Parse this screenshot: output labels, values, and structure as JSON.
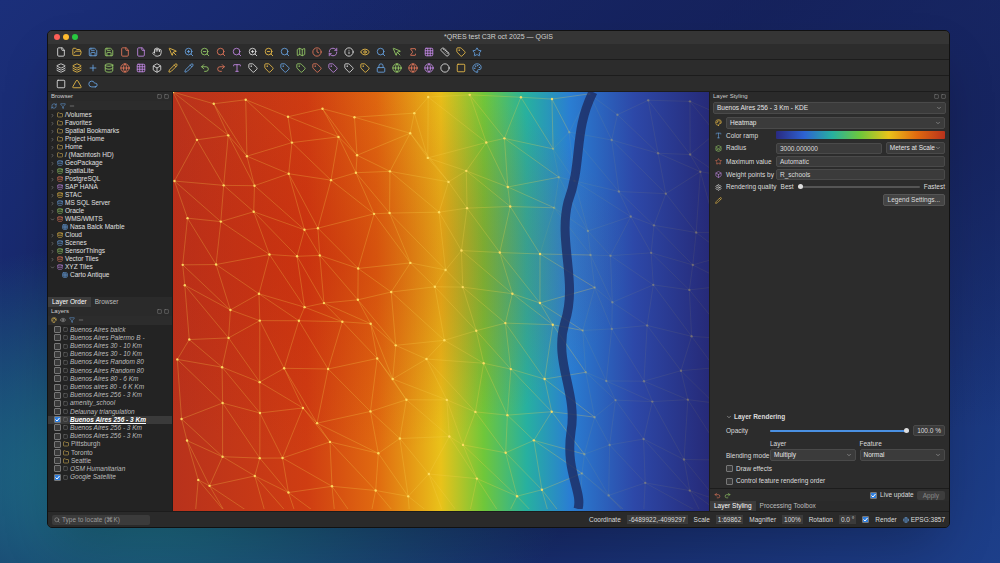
{
  "window": {
    "title": "*QRES test C3R oct 2025 — QGIS"
  },
  "browser": {
    "title": "Browser",
    "items": [
      {
        "label": "/Volumes",
        "kind": "group",
        "expanded": false
      },
      {
        "label": "Favorites",
        "kind": "group",
        "expanded": false
      },
      {
        "label": "Spatial Bookmarks",
        "kind": "group",
        "expanded": false
      },
      {
        "label": "Project Home",
        "kind": "group",
        "expanded": false
      },
      {
        "label": "Home",
        "kind": "group",
        "expanded": false
      },
      {
        "label": "/ (Macintosh HD)",
        "kind": "group",
        "expanded": false
      },
      {
        "label": "GeoPackage",
        "kind": "group",
        "expanded": false
      },
      {
        "label": "SpatiaLite",
        "kind": "group",
        "expanded": false
      },
      {
        "label": "PostgreSQL",
        "kind": "group",
        "expanded": false
      },
      {
        "label": "SAP HANA",
        "kind": "group",
        "expanded": false
      },
      {
        "label": "STAC",
        "kind": "group",
        "expanded": false
      },
      {
        "label": "MS SQL Server",
        "kind": "group",
        "expanded": false
      },
      {
        "label": "Oracle",
        "kind": "group",
        "expanded": false
      },
      {
        "label": "WMS/WMTS",
        "kind": "group",
        "expanded": true
      },
      {
        "label": "Nasa Balck Marble",
        "kind": "child",
        "expanded": false
      },
      {
        "label": "Cloud",
        "kind": "group",
        "expanded": false
      },
      {
        "label": "Scenes",
        "kind": "group",
        "expanded": false
      },
      {
        "label": "SensorThings",
        "kind": "group",
        "expanded": false
      },
      {
        "label": "Vector Tiles",
        "kind": "group",
        "expanded": false
      },
      {
        "label": "XYZ Tiles",
        "kind": "group",
        "expanded": true
      },
      {
        "label": "Carto Antique",
        "kind": "child",
        "expanded": false
      }
    ]
  },
  "dock_tabs": [
    {
      "label": "Layer Order",
      "selected": true
    },
    {
      "label": "Browser",
      "selected": false
    }
  ],
  "layers": {
    "title": "Layers",
    "items": [
      {
        "label": "Buenos Aires balck",
        "kind": "layer",
        "visible": false,
        "selected": false
      },
      {
        "label": "Buenos Aires Palermo B -",
        "kind": "layer",
        "visible": false,
        "selected": false
      },
      {
        "label": "Buenos Aires 30 - 10 Km",
        "kind": "layer",
        "visible": false,
        "selected": false
      },
      {
        "label": "Buenos Aires 30 - 10 Km",
        "kind": "layer",
        "visible": false,
        "selected": false
      },
      {
        "label": "Buenos Aires Random 80",
        "kind": "layer",
        "visible": false,
        "selected": false
      },
      {
        "label": "Buenos Aires Random 80",
        "kind": "layer",
        "visible": false,
        "selected": false
      },
      {
        "label": "Buenos Aires 80 - 6 Km",
        "kind": "layer",
        "visible": false,
        "selected": false
      },
      {
        "label": "Buenos aires 80 - 6 K Km",
        "kind": "layer",
        "visible": false,
        "selected": false
      },
      {
        "label": "Buenos Aires 256 - 3 Km",
        "kind": "layer",
        "visible": false,
        "selected": false
      },
      {
        "label": "amenity_school",
        "kind": "layer",
        "visible": false,
        "selected": false
      },
      {
        "label": "Delaunay triangulation",
        "kind": "layer",
        "visible": false,
        "selected": false
      },
      {
        "label": "Buenos Aires 256 - 3 Km",
        "kind": "layer",
        "visible": true,
        "selected": true
      },
      {
        "label": "Buenos Aires 256 - 3 Km",
        "kind": "layer",
        "visible": false,
        "selected": false
      },
      {
        "label": "Buenos Aires 256 - 3 Km",
        "kind": "layer",
        "visible": false,
        "selected": false
      },
      {
        "label": "Pittsburgh",
        "kind": "group",
        "visible": false,
        "selected": false
      },
      {
        "label": "Toronto",
        "kind": "group",
        "visible": false,
        "selected": false
      },
      {
        "label": "Seattle",
        "kind": "group",
        "visible": false,
        "selected": false
      },
      {
        "label": "OSM Humanitarian",
        "kind": "layer",
        "visible": false,
        "selected": false
      },
      {
        "label": "Google Satellite",
        "kind": "layer",
        "visible": true,
        "selected": false
      }
    ]
  },
  "styling": {
    "title": "Layer Styling",
    "layer": "Buenos Aires 256 - 3 Km - KDE",
    "renderer": "Heatmap",
    "color_ramp_label": "Color ramp",
    "radius_label": "Radius",
    "radius": "3000.000000",
    "radius_unit": "Meters at Scale",
    "max_label": "Maximum value",
    "max": "Automatic",
    "weight_label": "Weight points by",
    "weight": "R_schools",
    "quality_label": "Rendering quality",
    "quality_low": "Best",
    "quality_high": "Fastest",
    "quality_level": 0,
    "legend_button": "Legend Settings...",
    "rendering_title": "Layer Rendering",
    "opacity_label": "Opacity",
    "opacity": "100.0 %",
    "opacity_level": 1,
    "blending_label": "Blending mode",
    "blend_layer_label": "Layer",
    "blend_layer": "Multiply",
    "blend_feature_label": "Feature",
    "blend_feature": "Normal",
    "draw_effects": {
      "label": "Draw effects",
      "checked": false
    },
    "render_order": {
      "label": "Control feature rendering order",
      "checked": false
    },
    "live_update": {
      "label": "Live update",
      "checked": true
    },
    "apply": "Apply",
    "tabs": [
      {
        "label": "Layer Styling",
        "selected": true
      },
      {
        "label": "Processing Toolbox",
        "selected": false
      }
    ]
  },
  "status_bar": {
    "search_placeholder": "Type to locate (⌘K)",
    "coordinate_label": "Coordinate",
    "coordinate": "-6489922,-4099297",
    "scale_label": "Scale",
    "scale": "1:69862",
    "magnifier_label": "Magnifier",
    "magnifier": "100%",
    "rotation_label": "Rotation",
    "rotation": "0.0 °",
    "render_label": "Render",
    "render": true,
    "crs": "EPSG:3857"
  }
}
